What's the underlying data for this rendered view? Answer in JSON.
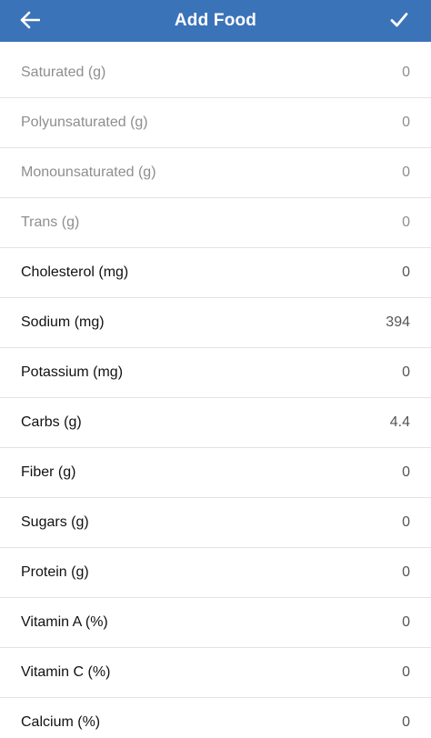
{
  "header": {
    "title": "Add Food",
    "back_icon": "arrow-left-icon",
    "confirm_icon": "checkmark-icon",
    "color": "#3b73b9"
  },
  "nutrients": [
    {
      "label": "Saturated (g)",
      "value": "0",
      "muted": true
    },
    {
      "label": "Polyunsaturated (g)",
      "value": "0",
      "muted": true
    },
    {
      "label": "Monounsaturated (g)",
      "value": "0",
      "muted": true
    },
    {
      "label": "Trans (g)",
      "value": "0",
      "muted": true
    },
    {
      "label": "Cholesterol (mg)",
      "value": "0",
      "muted": false
    },
    {
      "label": "Sodium (mg)",
      "value": "394",
      "muted": false
    },
    {
      "label": "Potassium (mg)",
      "value": "0",
      "muted": false
    },
    {
      "label": "Carbs (g)",
      "value": "4.4",
      "muted": false
    },
    {
      "label": "Fiber (g)",
      "value": "0",
      "muted": false
    },
    {
      "label": "Sugars (g)",
      "value": "0",
      "muted": false
    },
    {
      "label": "Protein (g)",
      "value": "0",
      "muted": false
    },
    {
      "label": "Vitamin A (%)",
      "value": "0",
      "muted": false
    },
    {
      "label": "Vitamin C (%)",
      "value": "0",
      "muted": false
    },
    {
      "label": "Calcium (%)",
      "value": "0",
      "muted": false
    }
  ]
}
